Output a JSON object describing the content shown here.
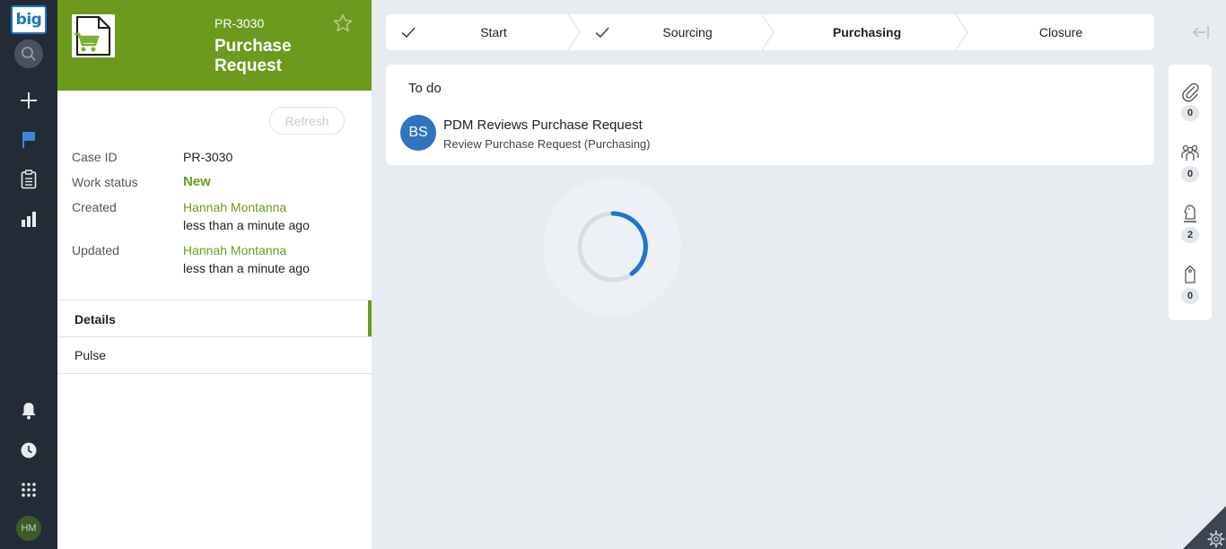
{
  "nav": {
    "logo_text": "big",
    "avatar_initials": "HM",
    "icons": [
      "search-icon",
      "plus-icon",
      "flag-icon",
      "clipboard-icon",
      "bar-chart-icon",
      "bell-icon",
      "history-icon",
      "apps-grid-icon"
    ]
  },
  "case": {
    "id": "PR-3030",
    "title": "Purchase Request",
    "refresh_label": "Refresh",
    "fields": {
      "case_id_label": "Case ID",
      "case_id_value": "PR-3030",
      "work_status_label": "Work status",
      "work_status_value": "New",
      "created_label": "Created",
      "created_by": "Hannah Montanna",
      "created_when": "less than a minute ago",
      "updated_label": "Updated",
      "updated_by": "Hannah Montanna",
      "updated_when": "less than a minute ago"
    },
    "tabs": [
      {
        "label": "Details",
        "active": true
      },
      {
        "label": "Pulse",
        "active": false
      }
    ]
  },
  "stages": [
    {
      "label": "Start",
      "completed": true
    },
    {
      "label": "Sourcing",
      "completed": true
    },
    {
      "label": "Purchasing",
      "current": true
    },
    {
      "label": "Closure"
    }
  ],
  "todo": {
    "title": "To do",
    "items": [
      {
        "initials": "BS",
        "title": "PDM Reviews Purchase Request",
        "subtitle": "Review Purchase Request (Purchasing)"
      }
    ]
  },
  "utility": [
    {
      "icon": "paperclip-icon",
      "count": "0"
    },
    {
      "icon": "followers-icon",
      "count": "0"
    },
    {
      "icon": "chess-knight-icon",
      "count": "2"
    },
    {
      "icon": "tag-icon",
      "count": "0"
    }
  ],
  "colors": {
    "brand_green": "#6b9a1f",
    "nav_dark": "#232c36",
    "accent_blue": "#2f74bd",
    "background": "#e8ecf0"
  }
}
